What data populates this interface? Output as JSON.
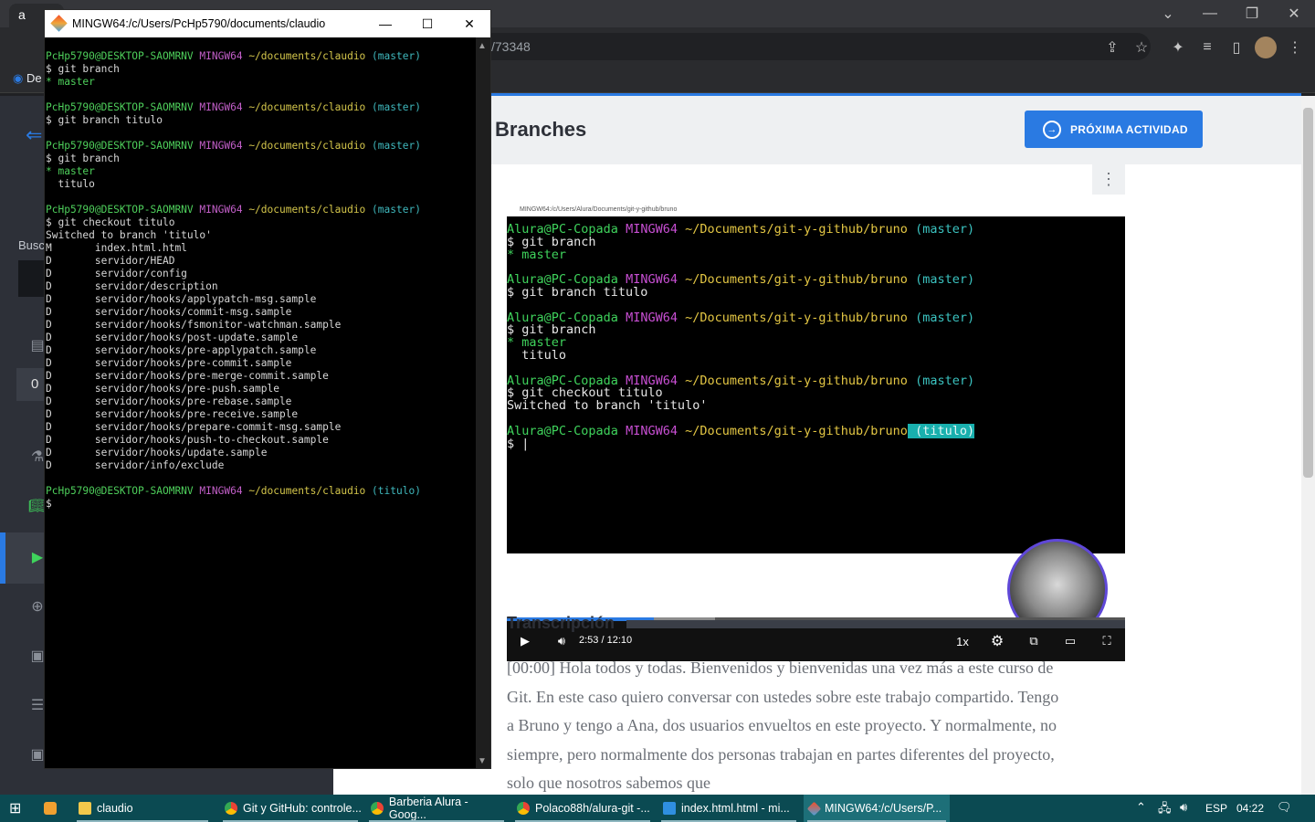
{
  "chrome": {
    "tab_title": "a",
    "url_fragment": "/73348",
    "bookmark": "De"
  },
  "sidebar": {
    "search_label": "Busc",
    "item_number": "0"
  },
  "page": {
    "title": "Branches",
    "next_button": "PRÓXIMA ACTIVIDAD",
    "transcript_title": "Transcripción",
    "transcript_text": "[00:00] Hola todos y todas. Bienvenidos y bienvenidas una vez más a este curso de Git. En este caso quiero conversar con ustedes sobre este trabajo compartido. Tengo a Bruno y tengo a Ana, dos usuarios envueltos en este proyecto. Y normalmente, no siempre, pero normalmente dos personas trabajan en partes diferentes del proyecto, solo que nosotros sabemos que"
  },
  "video": {
    "window_title": "MINGW64:/c/Users/Alura/Documents/git-y-github/bruno",
    "current_time": "2:53",
    "separator": "/",
    "duration": "12:10",
    "speed": "1x",
    "progress": 0.238,
    "buffered": 0.337,
    "prompt_user": "Alura@PC-Copada",
    "prompt_host": "MINGW64",
    "prompt_path": "~/Documents/git-y-github/bruno",
    "branch_master": "(master)",
    "branch_titulo": "(titulo)",
    "cmd1": "$ git branch",
    "out_master": "* master",
    "cmd2": "$ git branch titulo",
    "out_titulo": "  titulo",
    "cmd4": "$ git checkout titulo",
    "out_switched": "Switched to branch 'titulo'",
    "cursor_line": "$ |"
  },
  "bash": {
    "window_title": "MINGW64:/c/Users/PcHp5790/documents/claudio",
    "prompt_user": "PcHp5790@DESKTOP-SAOMRNV",
    "prompt_host": "MINGW64",
    "prompt_path": "~/documents/claudio",
    "branch_master": "(master)",
    "branch_titulo": "(titulo)",
    "cmd_branch": "$ git branch",
    "out_master": "* master",
    "cmd_branch_titulo": "$ git branch titulo",
    "out_titulo": "  titulo",
    "cmd_checkout": "$ git checkout titulo",
    "out_switched": "Switched to branch 'titulo'",
    "changes": [
      "M       index.html.html",
      "D       servidor/HEAD",
      "D       servidor/config",
      "D       servidor/description",
      "D       servidor/hooks/applypatch-msg.sample",
      "D       servidor/hooks/commit-msg.sample",
      "D       servidor/hooks/fsmonitor-watchman.sample",
      "D       servidor/hooks/post-update.sample",
      "D       servidor/hooks/pre-applypatch.sample",
      "D       servidor/hooks/pre-commit.sample",
      "D       servidor/hooks/pre-merge-commit.sample",
      "D       servidor/hooks/pre-push.sample",
      "D       servidor/hooks/pre-rebase.sample",
      "D       servidor/hooks/pre-receive.sample",
      "D       servidor/hooks/prepare-commit-msg.sample",
      "D       servidor/hooks/push-to-checkout.sample",
      "D       servidor/hooks/update.sample",
      "D       servidor/info/exclude"
    ],
    "final_prompt": "$"
  },
  "taskbar": {
    "items": [
      "claudio",
      "Git y GitHub: controle...",
      "Barberia Alura - Goog...",
      "Polaco88h/alura-git -...",
      "index.html.html - mi...",
      "MINGW64:/c/Users/P..."
    ],
    "language": "ESP",
    "time": "04:22"
  },
  "colors": {
    "accent": "#2a7ae2",
    "taskbar": "#0b4a52",
    "prompt_green": "#4ecf5b",
    "prompt_magenta": "#c35fc9",
    "prompt_yellow": "#d4c64b",
    "prompt_cyan": "#3fb8bd"
  }
}
